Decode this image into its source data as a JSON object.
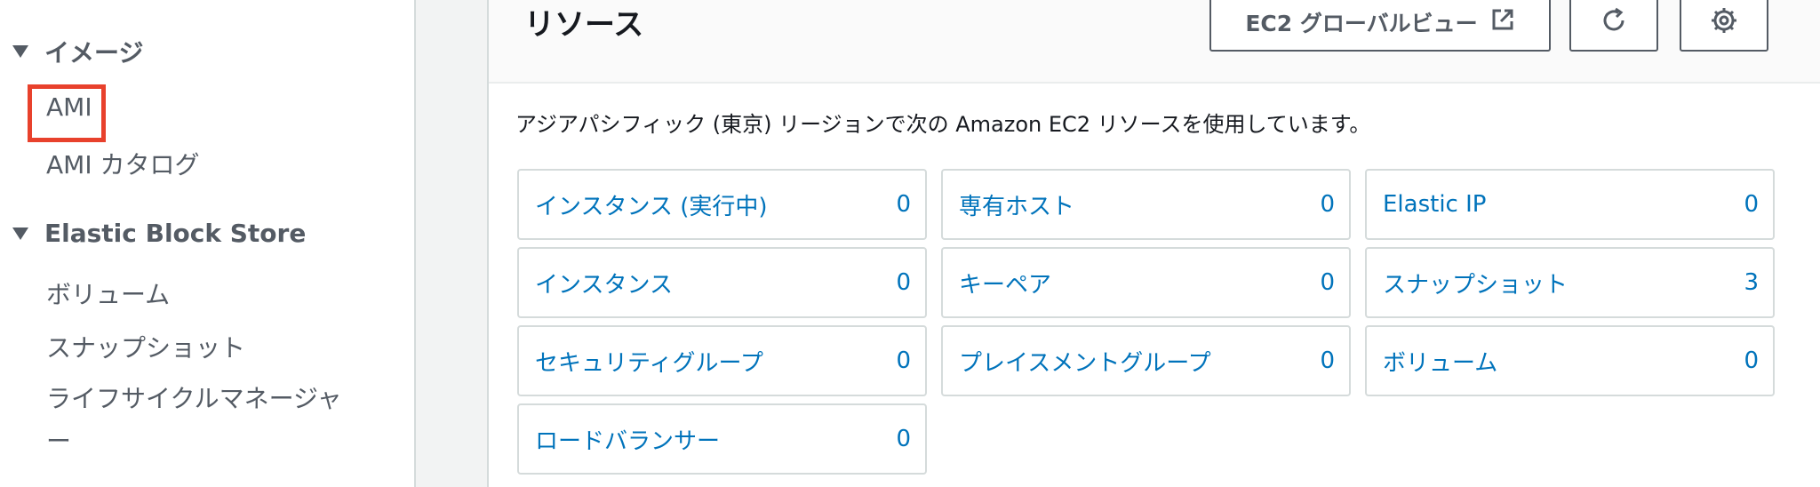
{
  "sidebar": {
    "images_section": {
      "title": "イメージ",
      "items": [
        "AMI",
        "AMI カタログ"
      ]
    },
    "ebs_section": {
      "title": "Elastic Block Store",
      "items": [
        "ボリューム",
        "スナップショット",
        "ライフサイクルマネージャー"
      ]
    }
  },
  "panel": {
    "title": "リソース",
    "global_view_button": "EC2 グローバルビュー",
    "description": "アジアパシフィック (東京) リージョンで次の Amazon EC2 リソースを使用しています。",
    "resources": [
      {
        "label": "インスタンス (実行中)",
        "count": "0"
      },
      {
        "label": "専有ホスト",
        "count": "0"
      },
      {
        "label": "Elastic IP",
        "count": "0"
      },
      {
        "label": "インスタンス",
        "count": "0"
      },
      {
        "label": "キーペア",
        "count": "0"
      },
      {
        "label": "スナップショット",
        "count": "3"
      },
      {
        "label": "セキュリティグループ",
        "count": "0"
      },
      {
        "label": "プレイスメントグループ",
        "count": "0"
      },
      {
        "label": "ボリューム",
        "count": "0"
      },
      {
        "label": "ロードバランサー",
        "count": "0"
      }
    ]
  },
  "icons": {
    "section_toggle": "caret-down-icon",
    "external": "external-link-icon",
    "refresh": "refresh-icon",
    "settings": "gear-icon"
  },
  "colors": {
    "link": "#0073bb",
    "highlight": "#e8412c",
    "nav_text": "#545b64"
  }
}
